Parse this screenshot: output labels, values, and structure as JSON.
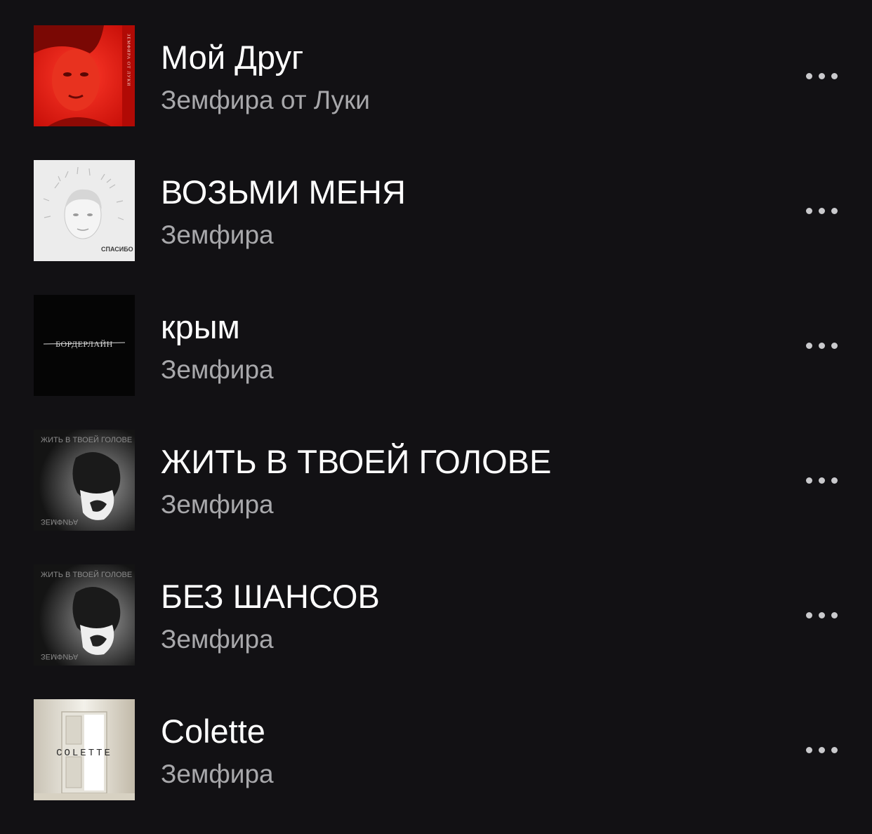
{
  "tracks": [
    {
      "title": "Мой Друг",
      "artist": "Земфира от Луки",
      "cover": "album-cover-red-portrait",
      "cover_text": "ЗЕМФИРА ОТ ЛУКИ"
    },
    {
      "title": "ВОЗЬМИ МЕНЯ",
      "artist": "Земфира",
      "cover": "album-cover-spasibo",
      "cover_text": "СПАСИБО"
    },
    {
      "title": "крым",
      "artist": "Земфира",
      "cover": "album-cover-borderline",
      "cover_text": "БОРДЕРЛАЙН"
    },
    {
      "title": "ЖИТЬ В ТВОЕЙ ГОЛОВЕ",
      "artist": "Земфира",
      "cover": "album-cover-zhit-v-tvoey-golove",
      "cover_text": "ЖИТЬ В ТВОЕЙ ГОЛОВЕ",
      "cover_text_bottom": "ЗЕМФИРА"
    },
    {
      "title": "БЕЗ ШАНСОВ",
      "artist": "Земфира",
      "cover": "album-cover-zhit-v-tvoey-golove",
      "cover_text": "ЖИТЬ В ТВОЕЙ ГОЛОВЕ",
      "cover_text_bottom": "ЗЕМФИРА"
    },
    {
      "title": "Colette",
      "artist": "Земфира",
      "cover": "album-cover-colette",
      "cover_text": "COLETTE"
    }
  ],
  "more_icon": "more-horizontal-icon"
}
